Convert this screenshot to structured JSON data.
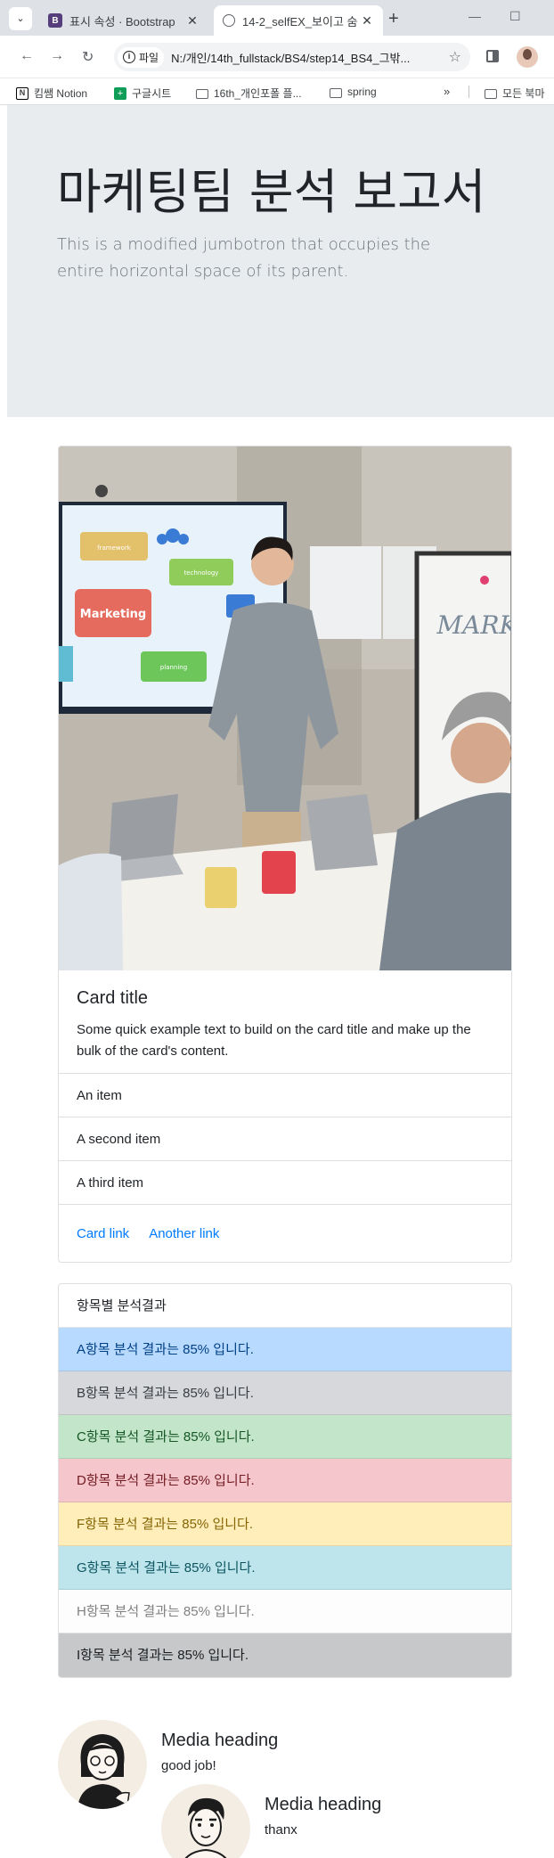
{
  "browser": {
    "tabs": [
      {
        "title": "표시 속성 · Bootstrap",
        "active": false
      },
      {
        "title": "14-2_selfEX_보이고 숨",
        "active": true
      }
    ],
    "address": {
      "chip": "파일",
      "url": "N:/개인/14th_fullstack/BS4/step14_BS4_그밖..."
    },
    "bookmarks": [
      "킴쌤 Notion",
      "구글시트",
      "16th_개인포폴 플...",
      "spring",
      "모든 북마"
    ]
  },
  "jumbotron": {
    "heading": "마케팅팀 분석 보고서",
    "lead": "This is a modified jumbotron that occupies the entire horizontal space of its parent."
  },
  "card": {
    "image": {
      "screen_words": [
        "framework",
        "technology",
        "Marketing",
        "planning"
      ],
      "whiteboard_text": "MARK"
    },
    "title": "Card title",
    "text": "Some quick example text to build on the card title and make up the bulk of the card's content.",
    "items": [
      "An item",
      "A second item",
      "A third item"
    ],
    "links": [
      "Card link",
      "Another link"
    ]
  },
  "list_group": {
    "header": "항목별 분석결과",
    "items": [
      "A항목 분석 결과는 85% 입니다.",
      "B항목 분석 결과는 85% 입니다.",
      "C항목 분석 결과는 85% 입니다.",
      "D항목 분석 결과는 85% 입니다.",
      "F항목 분석 결과는 85% 입니다.",
      "G항목 분석 결과는 85% 입니다.",
      "H항목 분석 결과는 85% 입니다.",
      "I항목 분석 결과는 85% 입니다."
    ]
  },
  "media": [
    {
      "heading": "Media heading",
      "text": "good job!"
    },
    {
      "heading": "Media heading",
      "text": "thanx"
    }
  ]
}
